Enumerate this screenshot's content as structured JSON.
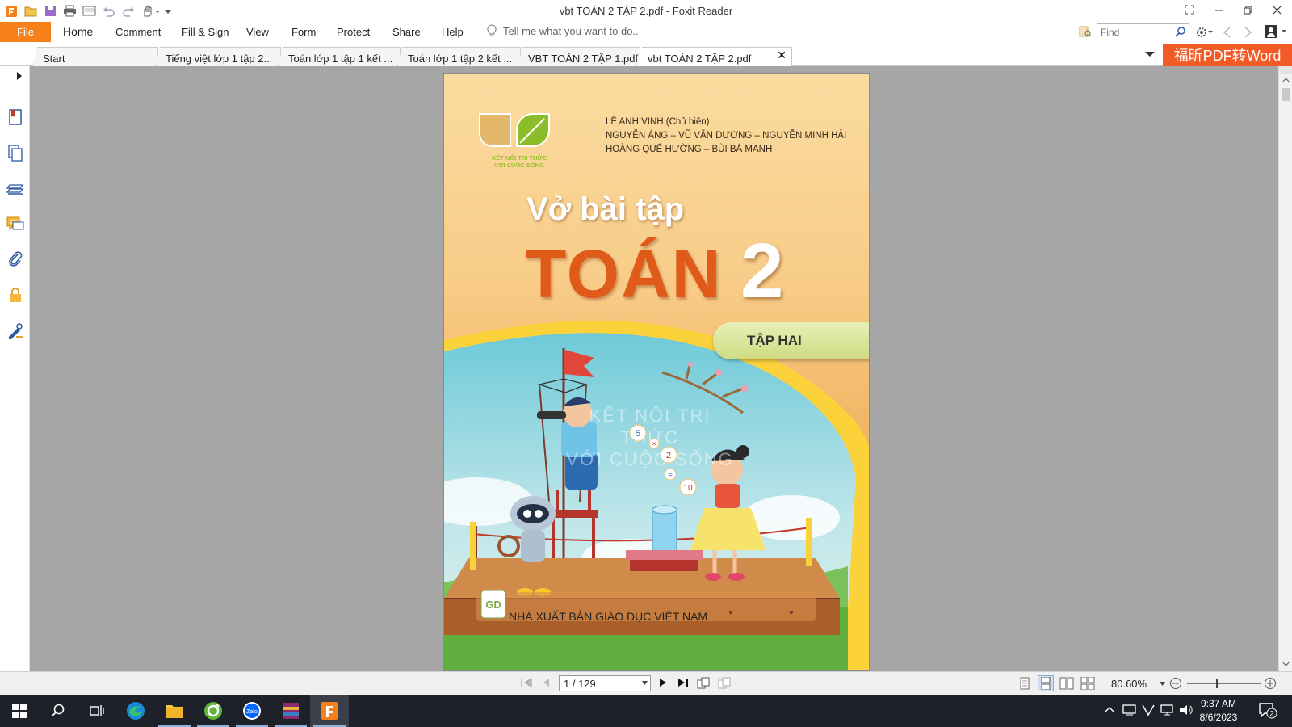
{
  "window": {
    "title": "vbt TOÁN 2 TẬP 2.pdf - Foxit Reader"
  },
  "ribbon": {
    "file": "File",
    "menus": [
      "Home",
      "Comment",
      "Fill & Sign",
      "View",
      "Form",
      "Protect",
      "Share",
      "Help"
    ],
    "tell_me_placeholder": "Tell me what you want to do..",
    "find_placeholder": "Find"
  },
  "tabs": [
    {
      "label": "Start",
      "active": false
    },
    {
      "label": "Tiếng việt lớp 1 tập 2...",
      "active": false
    },
    {
      "label": "Toán lớp 1 tập 1 kết ...",
      "active": false
    },
    {
      "label": "Toán lớp 1 tập 2 kết ...",
      "active": false
    },
    {
      "label": "VBT TOÁN 2 TẬP 1.pdf",
      "active": false
    },
    {
      "label": "vbt TOÁN 2 TẬP 2.pdf",
      "active": true
    }
  ],
  "tab_close_glyph": "✕",
  "convert_banner": "福昕PDF转Word",
  "side_panel_icons": [
    "bookmark-icon",
    "pages-icon",
    "layers-icon",
    "comments-icon",
    "attachments-icon",
    "security-icon",
    "signature-icon"
  ],
  "cover": {
    "authors": [
      "LÊ ANH VINH (Chủ biên)",
      "NGUYỄN ÁNG – VŨ VĂN DƯƠNG – NGUYỄN MINH HẢI",
      "HOÀNG QUẾ HƯỜNG – BÙI BÁ MẠNH"
    ],
    "logo_text": [
      "KẾT NỐI TRI THỨC",
      "VỚI CUỘC SỐNG"
    ],
    "subtitle": "Vở bài tập",
    "title": "TOÁN",
    "number": "2",
    "volume": "TẬP HAI",
    "watermark": [
      "KẾT NỐI TRI THỨC",
      "VỚI CUỘC SỐNG"
    ],
    "publisher": "NHÀ XUẤT BẢN GIÁO DỤC VIỆT NAM",
    "publisher_logo": "GD",
    "balloons": [
      "5",
      "×",
      "2",
      "=",
      "10"
    ]
  },
  "status": {
    "page_indicator": "1 / 129",
    "zoom": "80.60%"
  },
  "taskbar": {
    "apps": [
      "windows-start",
      "search",
      "task-view",
      "edge",
      "file-explorer",
      "green-app",
      "zalo",
      "winrar",
      "foxit-reader"
    ],
    "time": "9:37 AM",
    "date": "8/6/2023",
    "notifications": "2"
  },
  "colors": {
    "accent": "#f7801b",
    "banner": "#f25a26",
    "title_orange": "#e05a1a",
    "doc_bg": "#a6a6a6",
    "taskbar": "#1e2129"
  }
}
